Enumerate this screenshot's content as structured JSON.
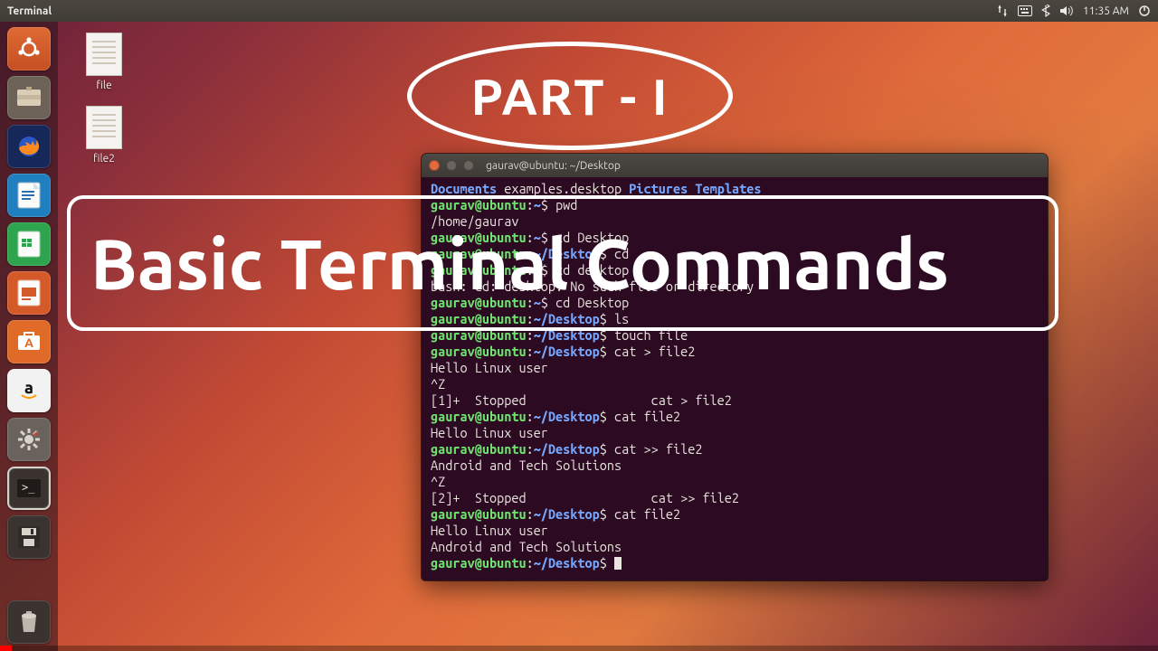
{
  "top_panel": {
    "title": "Terminal",
    "time": "11:35 AM"
  },
  "desktop_files": [
    {
      "label": "file"
    },
    {
      "label": "file2"
    }
  ],
  "launcher": {
    "items": [
      {
        "name": "dash-icon"
      },
      {
        "name": "files-icon"
      },
      {
        "name": "firefox-icon"
      },
      {
        "name": "libreoffice-writer-icon"
      },
      {
        "name": "libreoffice-calc-icon"
      },
      {
        "name": "libreoffice-impress-icon"
      },
      {
        "name": "ubuntu-software-icon"
      },
      {
        "name": "amazon-icon"
      },
      {
        "name": "system-settings-icon"
      },
      {
        "name": "terminal-icon"
      },
      {
        "name": "save-icon"
      }
    ]
  },
  "overlays": {
    "part_label": "PART - I",
    "subtitle": "Basic Terminal Commands"
  },
  "terminal": {
    "title": "gaurav@ubuntu: ~/Desktop",
    "prompt": {
      "user_host": "gaurav@ubuntu",
      "home": "~",
      "desktop": "~/Desktop",
      "sep": ":",
      "sigil": "$"
    },
    "dir_listing": {
      "dirs": [
        "Documents"
      ],
      "files": [
        "examples.desktop"
      ],
      "dirs2": [
        "Pictures",
        "Templates"
      ]
    },
    "lines": [
      {
        "type": "cmd",
        "path": "~",
        "text": "pwd"
      },
      {
        "type": "out",
        "text": "/home/gaurav"
      },
      {
        "type": "cmd",
        "path": "~",
        "text": "cd Desktop"
      },
      {
        "type": "cmd",
        "path": "~/Desktop",
        "text": "cd"
      },
      {
        "type": "cmd",
        "path": "~",
        "text": "cd desktop"
      },
      {
        "type": "out",
        "text": "bash: cd: desktop: No such file or directory"
      },
      {
        "type": "cmd",
        "path": "~",
        "text": "cd Desktop"
      },
      {
        "type": "cmd",
        "path": "~/Desktop",
        "text": "ls"
      },
      {
        "type": "cmd",
        "path": "~/Desktop",
        "text": "touch file"
      },
      {
        "type": "cmd",
        "path": "~/Desktop",
        "text": "cat > file2"
      },
      {
        "type": "out",
        "text": "Hello Linux user"
      },
      {
        "type": "out",
        "text": "^Z"
      },
      {
        "type": "out",
        "text": "[1]+  Stopped                 cat > file2"
      },
      {
        "type": "cmd",
        "path": "~/Desktop",
        "text": "cat file2"
      },
      {
        "type": "out",
        "text": "Hello Linux user"
      },
      {
        "type": "cmd",
        "path": "~/Desktop",
        "text": "cat >> file2"
      },
      {
        "type": "out",
        "text": "Android and Tech Solutions"
      },
      {
        "type": "out",
        "text": "^Z"
      },
      {
        "type": "out",
        "text": "[2]+  Stopped                 cat >> file2"
      },
      {
        "type": "cmd",
        "path": "~/Desktop",
        "text": "cat file2"
      },
      {
        "type": "out",
        "text": "Hello Linux user"
      },
      {
        "type": "out",
        "text": "Android and Tech Solutions"
      },
      {
        "type": "cmd",
        "path": "~/Desktop",
        "text": "",
        "cursor": true
      }
    ]
  }
}
